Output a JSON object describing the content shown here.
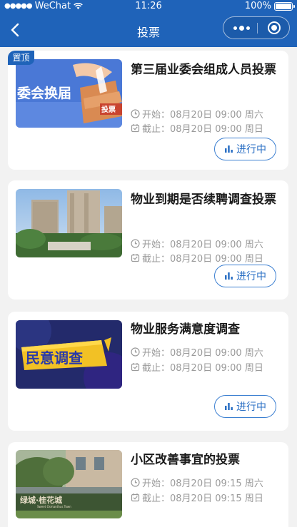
{
  "status_bar": {
    "carrier": "WeChat",
    "time": "11:26",
    "battery": "100%",
    "battery_level": 1.0
  },
  "nav": {
    "title": "投票"
  },
  "pin_label": "置顶",
  "polls": [
    {
      "title": "第三届业委会组成人员投票",
      "start": "开始：08月20日 09:00 周六",
      "end": "截止：08月20日 09:00 周日",
      "status": "进行中",
      "pinned": true,
      "image_text": [
        "委会换届",
        "投票"
      ]
    },
    {
      "title": "物业到期是否续聘调查投票",
      "start": "开始：08月20日 09:00 周六",
      "end": "截止：08月20日 09:00 周日",
      "status": "进行中",
      "pinned": false
    },
    {
      "title": "物业服务满意度调查",
      "start": "开始：08月20日 09:00 周六",
      "end": "截止：08月20日 09:00 周日",
      "status": "进行中",
      "pinned": false,
      "image_text": [
        "民意调查"
      ]
    },
    {
      "title": "小区改善事宜的投票",
      "start": "开始：08月20日 09:15 周六",
      "end": "截止：08月20日 09:15 周日",
      "status": "进行中",
      "pinned": false,
      "image_text": [
        "绿城·桂花城",
        "Sweet Osmanthus Town"
      ]
    }
  ],
  "colors": {
    "primary": "#1f63b9",
    "status_border": "#3b7fd1",
    "text_gray": "#9a9a9a"
  },
  "icons": [
    "back-icon",
    "more-icon",
    "close-circle-icon",
    "clock-icon",
    "calendar-icon",
    "bar-chart-icon"
  ]
}
